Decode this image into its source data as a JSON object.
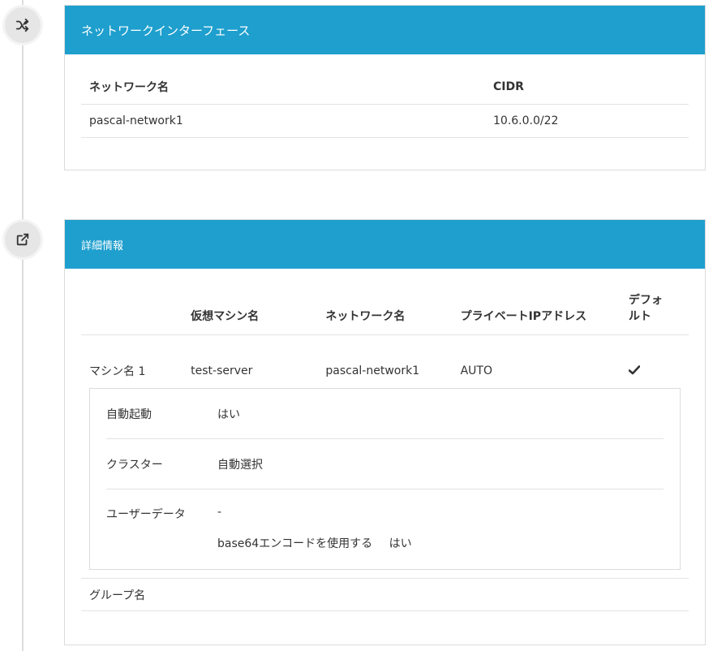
{
  "network_section": {
    "icon": "shuffle-icon",
    "title": "ネットワークインターフェース",
    "columns": [
      "ネットワーク名",
      "CIDR"
    ],
    "rows": [
      [
        "pascal-network1",
        "10.6.0.0/22"
      ]
    ]
  },
  "detail_section": {
    "icon": "external-link-icon",
    "title": "詳細情報",
    "columns": [
      "",
      "仮想マシン名",
      "ネットワーク名",
      "プライベートIPアドレス",
      "デフォルト"
    ],
    "machine": {
      "label": "マシン名 1",
      "vm_name": "test-server",
      "network": "pascal-network1",
      "private_ip": "AUTO",
      "default_icon": "check-icon"
    },
    "settings": {
      "autostart_label": "自動起動",
      "autostart_value": "はい",
      "cluster_label": "クラスター",
      "cluster_value": "自動選択",
      "userdata_label": "ユーザーデータ",
      "userdata_value": "-",
      "base64_label": "base64エンコードを使用する",
      "base64_value": "はい"
    },
    "group_label": "グループ名"
  },
  "colors": {
    "header_bg": "#1e9fce",
    "border": "#dcdcdc"
  }
}
